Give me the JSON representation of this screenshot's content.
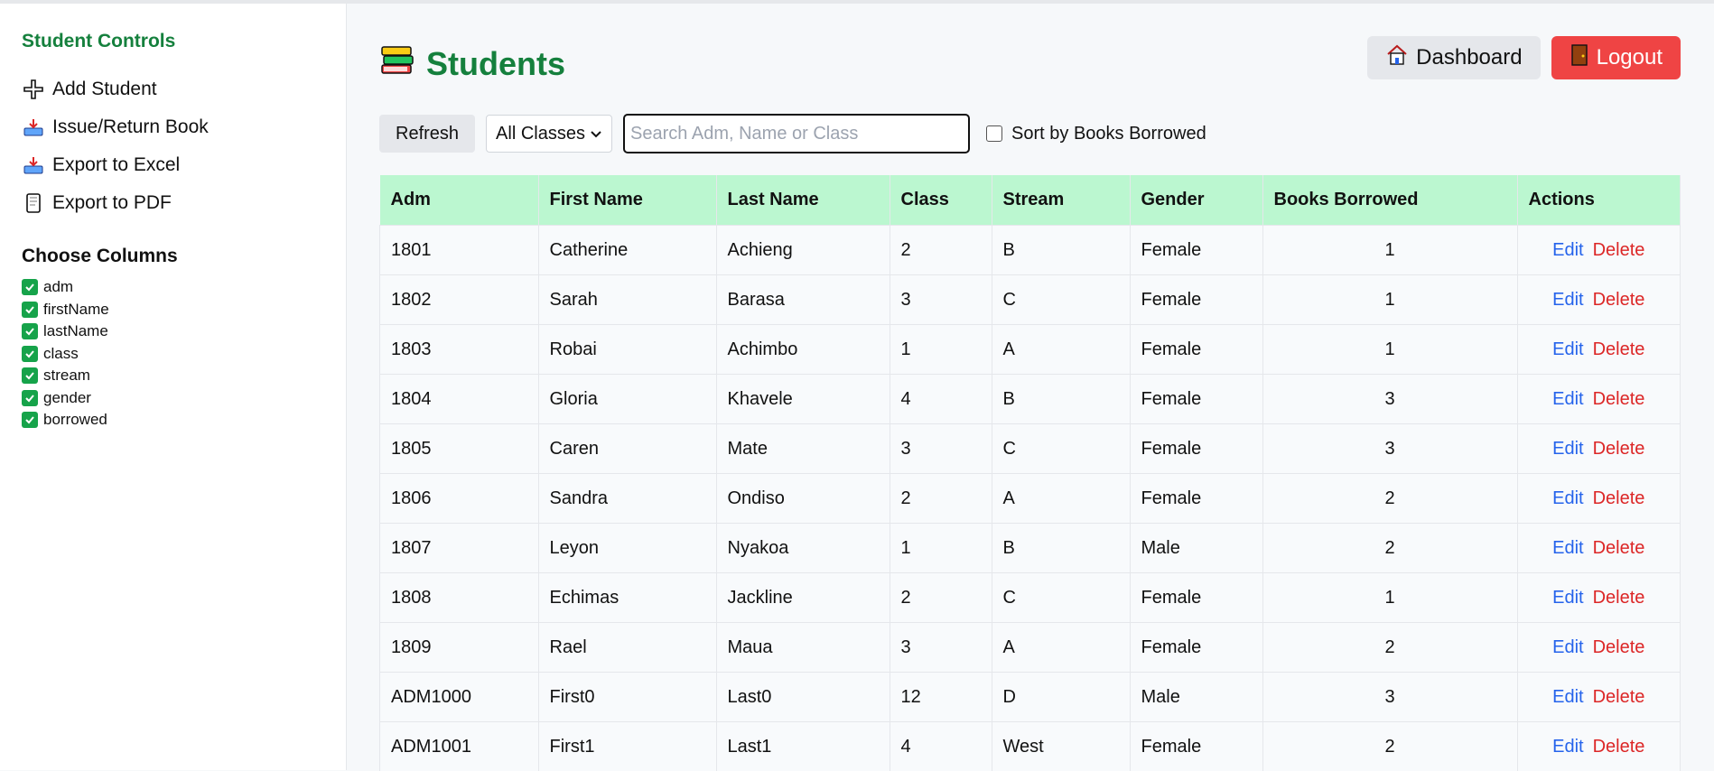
{
  "sidebar": {
    "title": "Student Controls",
    "items": [
      {
        "label": "Add Student",
        "icon": "plus-icon"
      },
      {
        "label": "Issue/Return Book",
        "icon": "inbox-tray-icon"
      },
      {
        "label": "Export to Excel",
        "icon": "inbox-tray-icon"
      },
      {
        "label": "Export to PDF",
        "icon": "scroll-icon"
      }
    ],
    "columns_title": "Choose Columns",
    "columns": [
      {
        "label": "adm",
        "checked": true
      },
      {
        "label": "firstName",
        "checked": true
      },
      {
        "label": "lastName",
        "checked": true
      },
      {
        "label": "class",
        "checked": true
      },
      {
        "label": "stream",
        "checked": true
      },
      {
        "label": "gender",
        "checked": true
      },
      {
        "label": "borrowed",
        "checked": true
      }
    ]
  },
  "header": {
    "title": "Students",
    "dashboard_label": "Dashboard",
    "logout_label": "Logout"
  },
  "toolbar": {
    "refresh_label": "Refresh",
    "class_filter": "All Classes",
    "search_placeholder": "Search Adm, Name or Class",
    "sort_label": "Sort by Books Borrowed"
  },
  "colors": {
    "accent": "#15803d",
    "header_row": "#bbf7d0",
    "logout": "#ef4444",
    "edit": "#2563eb",
    "delete": "#dc2626"
  },
  "table": {
    "columns": [
      "Adm",
      "First Name",
      "Last Name",
      "Class",
      "Stream",
      "Gender",
      "Books Borrowed",
      "Actions"
    ],
    "edit_label": "Edit",
    "delete_label": "Delete",
    "rows": [
      [
        "1801",
        "Catherine",
        "Achieng",
        "2",
        "B",
        "Female",
        "1"
      ],
      [
        "1802",
        "Sarah",
        "Barasa",
        "3",
        "C",
        "Female",
        "1"
      ],
      [
        "1803",
        "Robai",
        "Achimbo",
        "1",
        "A",
        "Female",
        "1"
      ],
      [
        "1804",
        "Gloria",
        "Khavele",
        "4",
        "B",
        "Female",
        "3"
      ],
      [
        "1805",
        "Caren",
        "Mate",
        "3",
        "C",
        "Female",
        "3"
      ],
      [
        "1806",
        "Sandra",
        "Ondiso",
        "2",
        "A",
        "Female",
        "2"
      ],
      [
        "1807",
        "Leyon",
        "Nyakoa",
        "1",
        "B",
        "Male",
        "2"
      ],
      [
        "1808",
        "Echimas",
        "Jackline",
        "2",
        "C",
        "Female",
        "1"
      ],
      [
        "1809",
        "Rael",
        "Maua",
        "3",
        "A",
        "Female",
        "2"
      ],
      [
        "ADM1000",
        "First0",
        "Last0",
        "12",
        "D",
        "Male",
        "3"
      ],
      [
        "ADM1001",
        "First1",
        "Last1",
        "4",
        "West",
        "Female",
        "2"
      ]
    ]
  }
}
